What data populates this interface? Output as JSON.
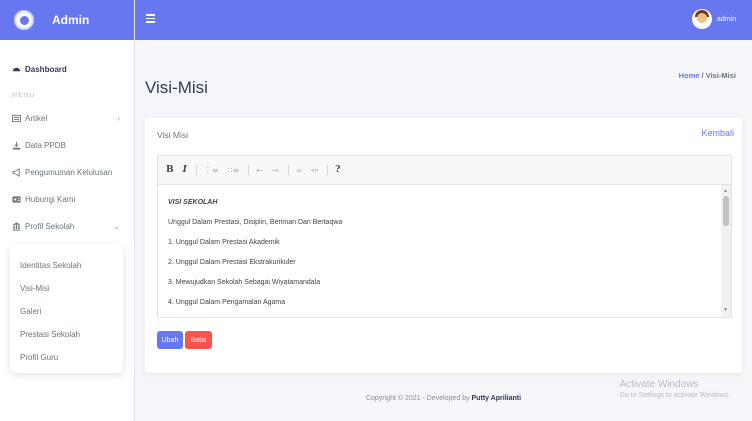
{
  "brand": {
    "title": "Admin"
  },
  "sidebar": {
    "menu_header": "MENU",
    "items": [
      {
        "label": "Dashboard",
        "icon": "dashboard-icon"
      },
      {
        "label": "Artikel",
        "icon": "article-icon"
      },
      {
        "label": "Data PPDB",
        "icon": "download-icon"
      },
      {
        "label": "Pengumuman Kelulusan",
        "icon": "megaphone-icon"
      },
      {
        "label": "Hubungi Kami",
        "icon": "contact-icon"
      },
      {
        "label": "Profil Sekolah",
        "icon": "school-icon"
      }
    ],
    "submenu": [
      {
        "label": "Identitas Sekolah"
      },
      {
        "label": "Visi-Misi"
      },
      {
        "label": "Galeri"
      },
      {
        "label": "Prestasi Sekolah"
      },
      {
        "label": "Profil Guru"
      }
    ]
  },
  "topbar": {
    "user_name": "admin"
  },
  "page": {
    "title": "Visi-Misi",
    "breadcrumb_home": "Home",
    "breadcrumb_sep": "/",
    "breadcrumb_current": "Visi-Misi"
  },
  "card": {
    "title": "Visi Misi",
    "back_link": "Kembali",
    "toolbar": [
      "B",
      "I",
      "?"
    ],
    "content": [
      "VISI SEKOLAH",
      "Unggul Dalam Prestasi, Disiplin, Beriman Dan Bertaqwa",
      "1. Unggul Dalam Prestasi Akademik",
      "2. Unggul Dalam Prestasi Ekstrakurikuler",
      "3. Mewujudkan Sekolah Sebagai Wiyatamandala",
      "4. Unggul Dalam Pengamalan Agama"
    ],
    "btn_save": "Ubah",
    "btn_cancel": "Batal"
  },
  "footer": {
    "text": "Copyright © 2021 - Developed by",
    "author": "Putty Aprilianti"
  },
  "watermark": {
    "line1": "Activate Windows",
    "line2": "Go to Settings to activate Windows."
  },
  "colors": {
    "primary": "#6777ef",
    "danger": "#fc544b"
  }
}
